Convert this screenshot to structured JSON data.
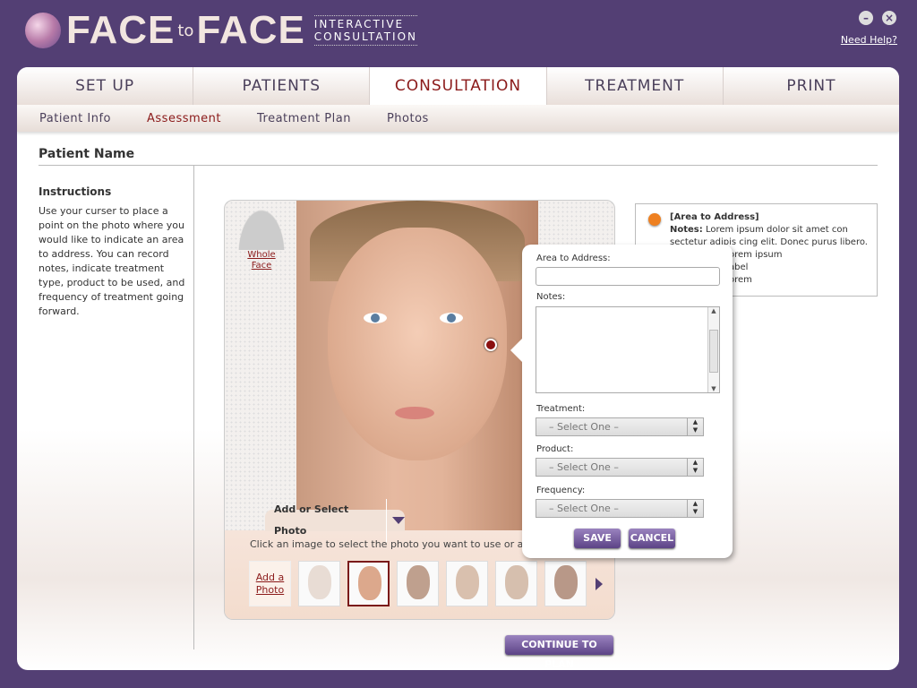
{
  "app": {
    "logo_main_1": "FACE",
    "logo_to": "to",
    "logo_main_2": "FACE",
    "logo_sub_1": "INTERACTIVE",
    "logo_sub_2": "CONSULTATION",
    "help": "Need Help?",
    "minimize": "–",
    "close": "×"
  },
  "tabs": [
    {
      "label": "SET UP"
    },
    {
      "label": "PATIENTS"
    },
    {
      "label": "CONSULTATION",
      "active": true
    },
    {
      "label": "TREATMENT"
    },
    {
      "label": "PRINT"
    }
  ],
  "subnav": [
    {
      "label": "Patient Info"
    },
    {
      "label": "Assessment",
      "active": true
    },
    {
      "label": "Treatment Plan"
    },
    {
      "label": "Photos"
    }
  ],
  "patient_name": "Patient Name",
  "instructions": {
    "title": "Instructions",
    "body": "Use your curser to place a point on the photo where you would like to indicate an area to address. You can record notes, indicate treatment type, product to be used, and frequency of treatment going forward."
  },
  "photo": {
    "whole_face_1": "Whole",
    "whole_face_2": "Face",
    "tray_tab": "Add or Select Photo",
    "tray_hint": "Click an image to select the photo you want to use or add a",
    "add_photo_1": "Add a",
    "add_photo_2": "Photo"
  },
  "note": {
    "title": "[Area to Address]",
    "notes_label": "Notes:",
    "notes_text": "Lorem ipsum dolor sit amet con sectetur adipis cing elit. Donec purus libero.",
    "line3": "orem ipsum",
    "line4": "abel",
    "line5": "orem",
    "dot_color": "#ee8020"
  },
  "popup": {
    "area_label": "Area to Address:",
    "area_value": "",
    "notes_label": "Notes:",
    "treatment_label": "Treatment:",
    "treatment_value": "– Select One –",
    "product_label": "Product:",
    "product_value": "– Select One –",
    "frequency_label": "Frequency:",
    "frequency_value": "– Select One –",
    "save": "SAVE",
    "cancel": "CANCEL"
  },
  "continue": "CONTINUE TO PLAN",
  "colors": {
    "brand": "#533f74",
    "active_text": "#8b1a1a"
  }
}
